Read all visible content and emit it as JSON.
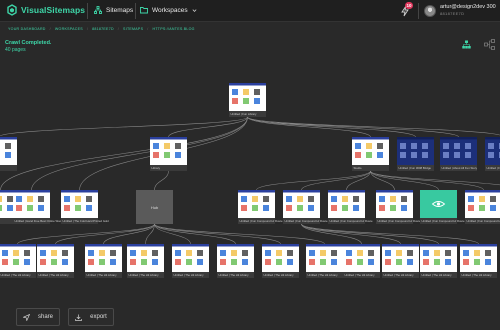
{
  "app": {
    "logo_text": "VisualSitemaps",
    "accent": "#3ed6a8",
    "nav": [
      {
        "label": "Sitemaps",
        "icon": "sitemap-icon"
      },
      {
        "label": "Workspaces",
        "icon": "folder-icon"
      }
    ]
  },
  "notifications": {
    "count": "10"
  },
  "user": {
    "email": "artur@design2dev 300",
    "id": "88187EE7D"
  },
  "breadcrumb": [
    "YOUR DASHBOARD",
    "WORKSPACES",
    "88187EE7D",
    "SITEMAPS",
    "HTTPS://ANTES.BLOG"
  ],
  "crawl": {
    "status": "Crawl Completed.",
    "pages": "40 pages"
  },
  "view_icons": [
    "tree-view-icon",
    "flow-view-icon"
  ],
  "graph": {
    "root": {
      "label": "Untitled | Fun Library",
      "shade": "white"
    },
    "level2": [
      {
        "label": "",
        "shade": "white"
      },
      {
        "label": "Library",
        "shade": "white"
      },
      {
        "label": "Studio",
        "shade": "white"
      },
      {
        "label": "Untitled | Fun 3008 Bridge",
        "shade": "navy"
      },
      {
        "label": "Untitled | About All Fun Story",
        "shade": "navy"
      },
      {
        "label": "Untitled | Fun Library",
        "shade": "navy"
      }
    ],
    "level3": [
      {
        "label": "",
        "shade": "white"
      },
      {
        "label": "Untitled | Hand Free Best Online Wood",
        "shade": "white"
      },
      {
        "label": "Untitled | The Cold Hard Printed Gold",
        "shade": "white"
      },
      {
        "label": "Hub",
        "shade": "hub"
      },
      {
        "label": "Untitled | Fun Compound Hr Route",
        "shade": "white"
      },
      {
        "label": "Untitled | Fun Compound Hr Route",
        "shade": "white"
      },
      {
        "label": "Untitled | Fun Compound Hr Route",
        "shade": "white"
      },
      {
        "label": "Untitled | Fun Compound Hr Route",
        "shade": "white"
      },
      {
        "label": "Untitled | Fun Compound Hr Route",
        "shade": "teal"
      },
      {
        "label": "Untitled | Fun Compound Hr Route",
        "shade": "white"
      },
      {
        "label": "",
        "shade": "white"
      }
    ],
    "level4": [
      {
        "label": "Untitled | The Hit Library"
      },
      {
        "label": "Untitled | The Hit Library"
      },
      {
        "label": "Untitled | The Hit Library"
      },
      {
        "label": "Untitled | The Hit Library"
      },
      {
        "label": "Untitled | The Hit Library"
      },
      {
        "label": "Untitled | The Hit Library"
      },
      {
        "label": "Untitled | The Hit Library"
      },
      {
        "label": "Untitled | The Hit Library"
      },
      {
        "label": "Untitled | The Hit Library"
      },
      {
        "label": "Untitled | The Hit Library"
      },
      {
        "label": "Untitled | The Hit Library"
      },
      {
        "label": "Untitled | The Hit Library"
      }
    ]
  },
  "actions": {
    "share": "share",
    "export": "export"
  }
}
